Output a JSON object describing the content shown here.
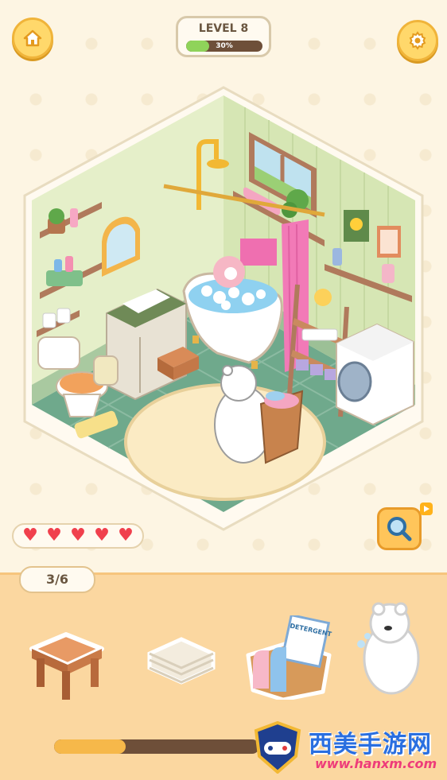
{
  "level": {
    "title": "LEVEL 8",
    "progress_text": "30%",
    "progress_fraction": 0.3
  },
  "buttons": {
    "home_icon": "home-icon",
    "settings_icon": "gear-icon",
    "hint_icon": "magnifier-icon"
  },
  "lives": {
    "count": 5,
    "icon": "heart-icon",
    "hearts": [
      "♥",
      "♥",
      "♥",
      "♥",
      "♥"
    ]
  },
  "items_counter": "3/6",
  "tray_items": [
    {
      "name": "wooden-stool",
      "icon": "stool-icon"
    },
    {
      "name": "folded-towels",
      "icon": "towels-icon"
    },
    {
      "name": "detergent-basket",
      "icon": "detergent-icon",
      "label": "DETERGENT"
    },
    {
      "name": "bear-character",
      "icon": "bear-icon"
    }
  ],
  "bottom_progress": {
    "fraction": 0.35
  },
  "watermark": {
    "title": "西美手游网",
    "url": "www.hanxm.com"
  },
  "colors": {
    "accent": "#ffd86b",
    "heart": "#f0404d",
    "progress": "#8fd35a",
    "tray": "#fbd7a0"
  }
}
